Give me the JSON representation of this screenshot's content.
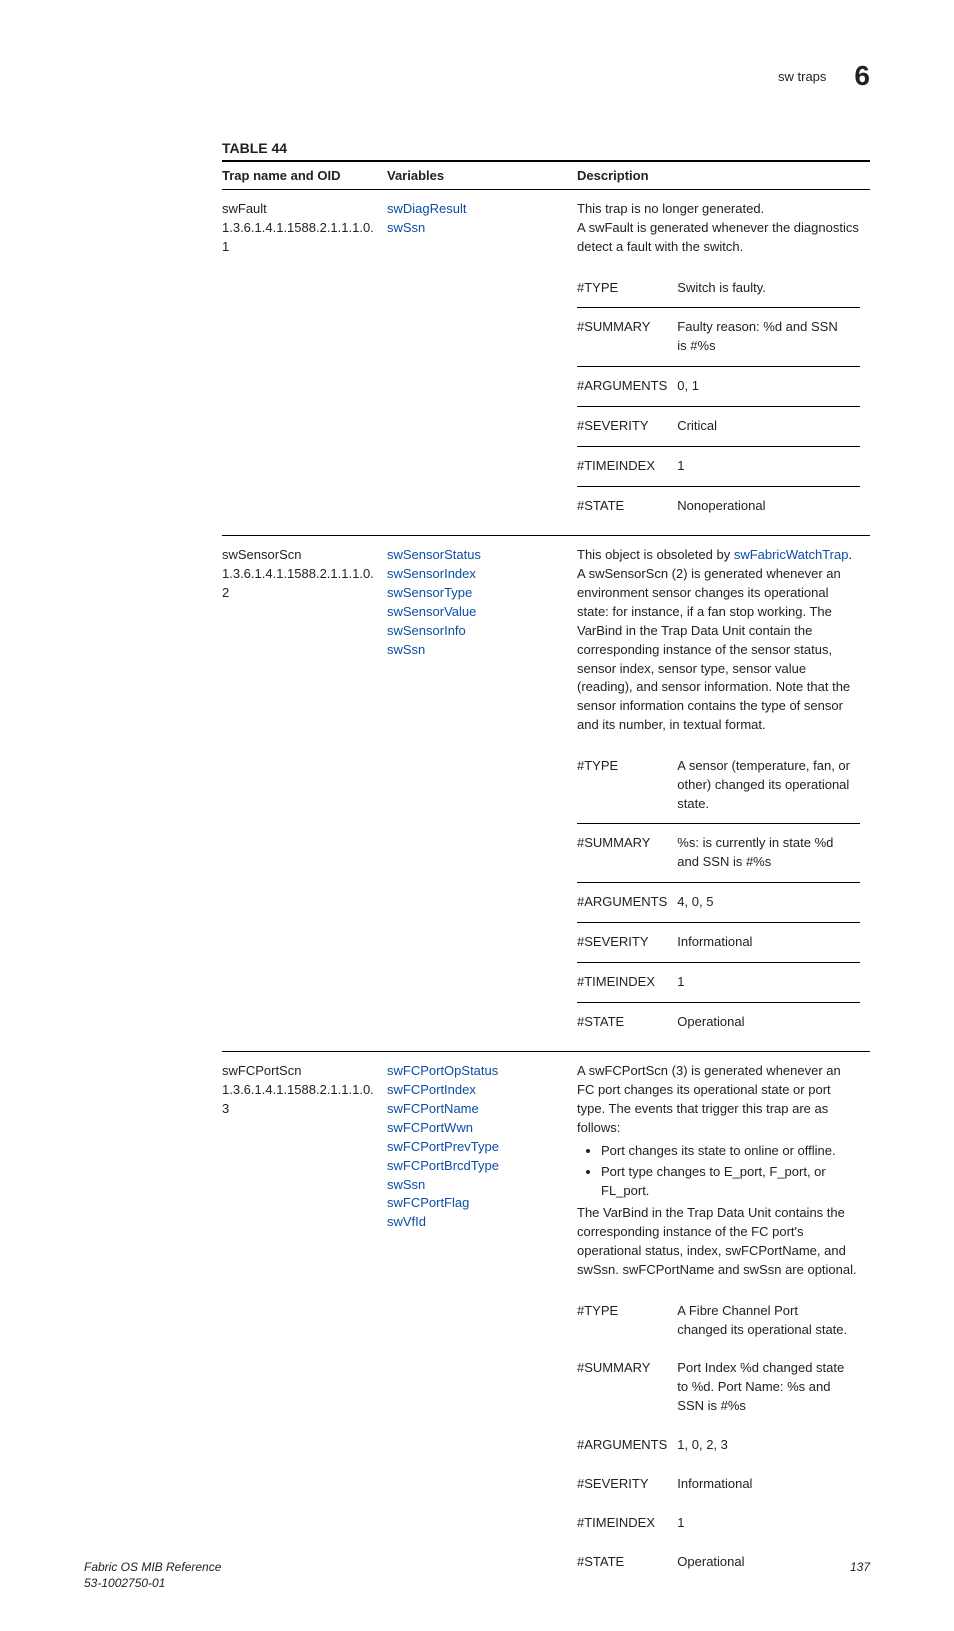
{
  "header": {
    "section": "sw traps",
    "chapter_number": "6"
  },
  "table_caption": "TABLE 44",
  "columns": {
    "trap": "Trap name and OID",
    "vars": "Variables",
    "desc": "Description"
  },
  "rows": [
    {
      "trap_name": "swFault",
      "oid": "1.3.6.1.4.1.1588.2.1.1.1.0.1",
      "variables": [
        "swDiagResult",
        "swSsn"
      ],
      "desc_intro_plain": "This trap is no longer generated.\nA swFault is generated whenever the diagnostics detect a fault with the switch.",
      "kv": {
        "type": "Switch is faulty.",
        "summary": "Faulty reason: %d and SSN is #%s",
        "arguments": "0, 1",
        "severity": "Critical",
        "timeindex": "1",
        "state": "Nonoperational"
      }
    },
    {
      "trap_name": "swSensorScn",
      "oid": "1.3.6.1.4.1.1588.2.1.1.1.0.2",
      "variables": [
        "swSensorStatus",
        "swSensorIndex",
        "swSensorType",
        "swSensorValue",
        "swSensorInfo",
        "swSsn"
      ],
      "desc_link_prefix": "This object is obsoleted by ",
      "desc_link": "swFabricWatchTrap",
      "desc_after_link": ". A swSensorScn (2) is generated whenever an environment sensor changes its operational state: for instance, if a fan stop working. The VarBind in the Trap Data Unit contain the corresponding instance of the sensor status, sensor index, sensor type, sensor value (reading), and sensor information. Note that the sensor information contains the type of sensor and its number, in textual format.",
      "kv": {
        "type": "A sensor (temperature, fan, or other) changed its operational state.",
        "summary": "%s: is currently in state %d and SSN is #%s",
        "arguments": "4, 0, 5",
        "severity": "Informational",
        "timeindex": "1",
        "state": "Operational"
      }
    },
    {
      "trap_name": "swFCPortScn",
      "oid": "1.3.6.1.4.1.1588.2.1.1.1.0.3",
      "variables": [
        "swFCPortOpStatus",
        "swFCPortIndex",
        "swFCPortName",
        "swFCPortWwn",
        "swFCPortPrevType",
        "swFCPortBrcdType",
        "swSsn",
        "swFCPortFlag",
        "swVfId"
      ],
      "desc_before_bullets": "A swFCPortScn (3) is generated whenever an FC port changes its operational state or port type. The events that trigger this trap are as follows:",
      "bullets": [
        "Port changes its state to online or offline.",
        "Port type changes to E_port, F_port, or FL_port."
      ],
      "desc_after_bullets": "The VarBind in the Trap Data Unit contains the corresponding instance of the FC port's operational status, index, swFCPortName, and swSsn. swFCPortName and swSsn are optional.",
      "kv": {
        "type": "A Fibre Channel Port changed its operational state.",
        "summary": "Port Index %d changed state to %d. Port Name: %s and SSN is #%s",
        "arguments": "1, 0, 2, 3",
        "severity": "Informational",
        "timeindex": "1",
        "state": "Operational"
      }
    }
  ],
  "kvlabels": {
    "type": "#TYPE",
    "summary": "#SUMMARY",
    "arguments": "#ARGUMENTS",
    "severity": "#SEVERITY",
    "timeindex": "#TIMEINDEX",
    "state": "#STATE"
  },
  "footer": {
    "doc_title": "Fabric OS MIB Reference",
    "doc_id": "53-1002750-01",
    "page_number": "137"
  }
}
